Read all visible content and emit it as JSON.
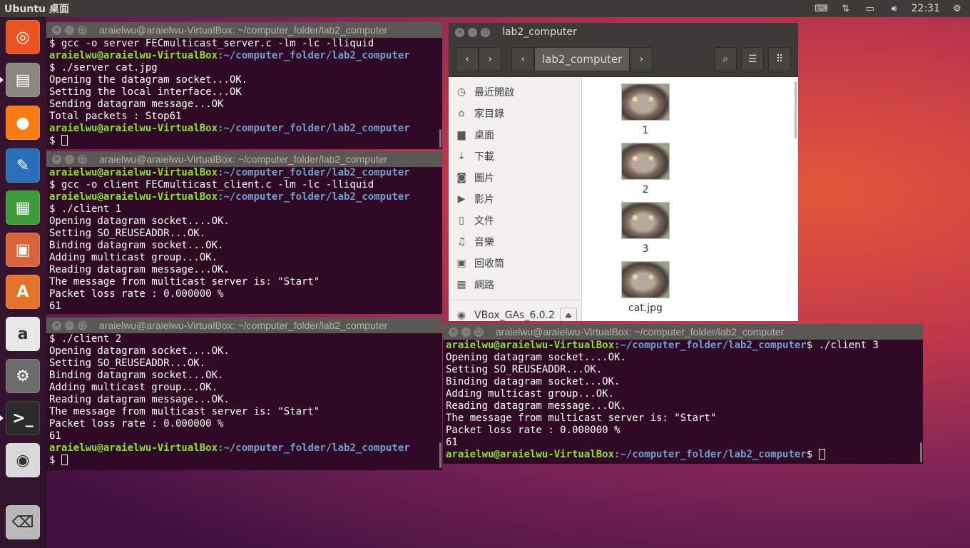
{
  "top_panel": {
    "app_title": "Ubuntu 桌面",
    "clock": "22:31",
    "tray_icons": [
      "keyboard-icon",
      "network-icon",
      "battery-icon",
      "volume-icon",
      "gear-icon"
    ]
  },
  "launcher": {
    "items": [
      {
        "name": "ubuntu-dash-icon",
        "color": "#e95420"
      },
      {
        "name": "files-icon",
        "color": "#8a8680"
      },
      {
        "name": "firefox-icon",
        "color": "#f77a14"
      },
      {
        "name": "writer-icon",
        "color": "#2a6fb8"
      },
      {
        "name": "calc-icon",
        "color": "#3e9a3a"
      },
      {
        "name": "impress-icon",
        "color": "#d9643a"
      },
      {
        "name": "software-center-icon",
        "color": "#e4742c"
      },
      {
        "name": "amazon-icon",
        "color": "#e8e8e8"
      },
      {
        "name": "system-settings-icon",
        "color": "#6d6d6d"
      },
      {
        "name": "terminal-icon",
        "color": "#2b2b2b"
      },
      {
        "name": "dvd-icon",
        "color": "#d9d9d9"
      },
      {
        "name": "trash-icon",
        "color": "#b9b9b9"
      }
    ]
  },
  "terminals": {
    "server": {
      "title": "araielwu@araielwu-VirtualBox: ~/computer_folder/lab2_computer",
      "lines": [
        {
          "text": "$ gcc -o server FECmulticast_server.c -lm -lc -lliquid"
        },
        {
          "prompt": true,
          "user": "araielwu@araielwu-VirtualBox",
          "path": ":~/computer_folder/lab2_computer",
          "text": ""
        },
        {
          "text": "$ ./server cat.jpg"
        },
        {
          "text": "Opening the datagram socket...OK."
        },
        {
          "text": "Setting the local interface...OK"
        },
        {
          "text": "Sending datagram message...OK"
        },
        {
          "text": "Total packets : Stop61"
        },
        {
          "prompt": true,
          "user": "araielwu@araielwu-VirtualBox",
          "path": ":~/computer_folder/lab2_computer",
          "text": ""
        },
        {
          "text": "$ ",
          "cursor": true
        }
      ]
    },
    "client1": {
      "title": "araielwu@araielwu-VirtualBox: ~/computer_folder/lab2_computer",
      "lines": [
        {
          "prompt": true,
          "user": "araielwu@araielwu-VirtualBox",
          "path": ":~/computer_folder/lab2_computer",
          "text": ""
        },
        {
          "text": "$ gcc -o client FECmulticast_client.c -lm -lc -lliquid"
        },
        {
          "prompt": true,
          "user": "araielwu@araielwu-VirtualBox",
          "path": ":~/computer_folder/lab2_computer",
          "text": ""
        },
        {
          "text": "$ ./client 1"
        },
        {
          "text": "Opening datagram socket....OK."
        },
        {
          "text": "Setting SO_REUSEADDR...OK."
        },
        {
          "text": "Binding datagram socket...OK."
        },
        {
          "text": "Adding multicast group...OK."
        },
        {
          "text": "Reading datagram message...OK."
        },
        {
          "text": "The message from multicast server is: \"Start\""
        },
        {
          "text": "Packet loss rate : 0.000000 %"
        },
        {
          "text": "61"
        }
      ]
    },
    "client2": {
      "title": "araielwu@araielwu-VirtualBox: ~/computer_folder/lab2_computer",
      "lines": [
        {
          "text": "$ ./client 2"
        },
        {
          "text": "Opening datagram socket....OK."
        },
        {
          "text": "Setting SO_REUSEADDR...OK."
        },
        {
          "text": "Binding datagram socket...OK."
        },
        {
          "text": "Adding multicast group...OK."
        },
        {
          "text": "Reading datagram message...OK."
        },
        {
          "text": "The message from multicast server is: \"Start\""
        },
        {
          "text": "Packet loss rate : 0.000000 %"
        },
        {
          "text": "61"
        },
        {
          "prompt": true,
          "user": "araielwu@araielwu-VirtualBox",
          "path": ":~/computer_folder/lab2_computer",
          "text": ""
        },
        {
          "text": "$ ",
          "cursor": true
        }
      ]
    },
    "client3": {
      "title": "araielwu@araielwu-VirtualBox: ~/computer_folder/lab2_computer",
      "lines": [
        {
          "prompt": true,
          "user": "araielwu@araielwu-VirtualBox",
          "path": ":~/computer_folder/lab2_computer",
          "text": "$ ./client 3"
        },
        {
          "text": "Opening datagram socket....OK."
        },
        {
          "text": "Setting SO_REUSEADDR...OK."
        },
        {
          "text": "Binding datagram socket...OK."
        },
        {
          "text": "Adding multicast group...OK."
        },
        {
          "text": "Reading datagram message...OK."
        },
        {
          "text": "The message from multicast server is: \"Start\""
        },
        {
          "text": "Packet loss rate : 0.000000 %"
        },
        {
          "text": "61"
        },
        {
          "prompt": true,
          "user": "araielwu@araielwu-VirtualBox",
          "path": ":~/computer_folder/lab2_computer",
          "text": "$ ",
          "cursor": true
        }
      ]
    }
  },
  "file_manager": {
    "title": "lab2_computer",
    "breadcrumb": "lab2_computer",
    "sidebar": [
      {
        "icon": "clock-icon",
        "glyph": "◷",
        "label": "最近開啟"
      },
      {
        "icon": "home-icon",
        "glyph": "⌂",
        "label": "家目錄"
      },
      {
        "icon": "desktop-folder-icon",
        "glyph": "▆",
        "label": "桌面"
      },
      {
        "icon": "download-icon",
        "glyph": "⇣",
        "label": "下載"
      },
      {
        "icon": "camera-icon",
        "glyph": "◙",
        "label": "圖片"
      },
      {
        "icon": "video-icon",
        "glyph": "▶",
        "label": "影片"
      },
      {
        "icon": "document-icon",
        "glyph": "▯",
        "label": "文件"
      },
      {
        "icon": "music-icon",
        "glyph": "♫",
        "label": "音樂"
      },
      {
        "icon": "trash-icon",
        "glyph": "▣",
        "label": "回收筒"
      },
      {
        "icon": "network-icon",
        "glyph": "▦",
        "label": "網路"
      }
    ],
    "drive": {
      "icon": "disc-icon",
      "glyph": "◉",
      "label": "VBox_GAs_6.0.2"
    },
    "files": [
      {
        "name": "1"
      },
      {
        "name": "2"
      },
      {
        "name": "3"
      },
      {
        "name": "cat.jpg"
      }
    ]
  }
}
